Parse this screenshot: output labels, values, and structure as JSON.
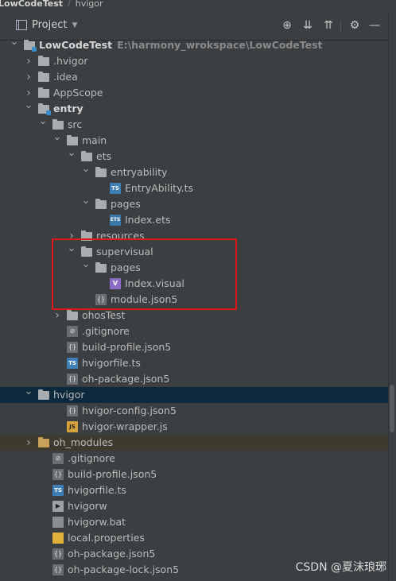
{
  "window_title": "LowCodeTest",
  "breadcrumb_tail": "hvigor",
  "panel": {
    "project_label": "Project",
    "icons": [
      "crosshair-icon",
      "expand-all-icon",
      "collapse-all-icon",
      "gear-icon",
      "minimize-icon"
    ]
  },
  "tree": [
    {
      "label": "LowCodeTest",
      "path": "E:\\harmony_wrokspace\\LowCodeTest",
      "level": 0,
      "expanded": true,
      "icon": "module-folder-icon",
      "bold": true
    },
    {
      "label": ".hvigor",
      "level": 1,
      "expanded": false,
      "icon": "folder-icon"
    },
    {
      "label": ".idea",
      "level": 1,
      "expanded": false,
      "icon": "folder-icon"
    },
    {
      "label": "AppScope",
      "level": 1,
      "expanded": false,
      "icon": "folder-icon"
    },
    {
      "label": "entry",
      "level": 1,
      "expanded": true,
      "icon": "module-folder-icon",
      "bold": true
    },
    {
      "label": "src",
      "level": 2,
      "expanded": true,
      "icon": "folder-icon"
    },
    {
      "label": "main",
      "level": 3,
      "expanded": true,
      "icon": "folder-icon"
    },
    {
      "label": "ets",
      "level": 4,
      "expanded": true,
      "icon": "folder-icon"
    },
    {
      "label": "entryability",
      "level": 5,
      "expanded": true,
      "icon": "folder-icon"
    },
    {
      "label": "EntryAbility.ts",
      "level": 6,
      "icon": "ts-file-icon"
    },
    {
      "label": "pages",
      "level": 5,
      "expanded": true,
      "icon": "folder-icon"
    },
    {
      "label": "Index.ets",
      "level": 6,
      "icon": "ets-file-icon"
    },
    {
      "label": "resources",
      "level": 4,
      "expanded": false,
      "icon": "folder-icon"
    },
    {
      "label": "supervisual",
      "level": 4,
      "expanded": true,
      "icon": "folder-icon"
    },
    {
      "label": "pages",
      "level": 5,
      "expanded": true,
      "icon": "folder-icon"
    },
    {
      "label": "Index.visual",
      "level": 6,
      "icon": "visual-file-icon"
    },
    {
      "label": "module.json5",
      "level": 5,
      "icon": "json-file-icon"
    },
    {
      "label": "ohosTest",
      "level": 3,
      "expanded": false,
      "icon": "folder-icon"
    },
    {
      "label": ".gitignore",
      "level": 3,
      "icon": "gitignore-file-icon"
    },
    {
      "label": "build-profile.json5",
      "level": 3,
      "icon": "json-file-icon"
    },
    {
      "label": "hvigorfile.ts",
      "level": 3,
      "icon": "ts-file-icon"
    },
    {
      "label": "oh-package.json5",
      "level": 3,
      "icon": "json-file-icon"
    },
    {
      "label": "hvigor",
      "level": 1,
      "expanded": true,
      "icon": "folder-icon",
      "selected": true
    },
    {
      "label": "hvigor-config.json5",
      "level": 3,
      "icon": "json-file-icon"
    },
    {
      "label": "hvigor-wrapper.js",
      "level": 3,
      "icon": "js-file-icon"
    },
    {
      "label": "oh_modules",
      "level": 1,
      "expanded": false,
      "icon": "orange-folder-icon",
      "modules": true
    },
    {
      "label": ".gitignore",
      "level": 2,
      "icon": "gitignore-file-icon"
    },
    {
      "label": "build-profile.json5",
      "level": 2,
      "icon": "json-file-icon"
    },
    {
      "label": "hvigorfile.ts",
      "level": 2,
      "icon": "ts-file-icon"
    },
    {
      "label": "hvigorw",
      "level": 2,
      "icon": "exec-file-icon"
    },
    {
      "label": "hvigorw.bat",
      "level": 2,
      "icon": "text-file-icon"
    },
    {
      "label": "local.properties",
      "level": 2,
      "icon": "properties-file-icon"
    },
    {
      "label": "oh-package.json5",
      "level": 2,
      "icon": "json-file-icon"
    },
    {
      "label": "oh-package-lock.json5",
      "level": 2,
      "icon": "json-file-icon"
    }
  ],
  "watermark": "CSDN @夏沫琅琊",
  "colors": {
    "selection": "#0d293e",
    "highlight_box": "#e01818",
    "background": "#3c3f41"
  }
}
